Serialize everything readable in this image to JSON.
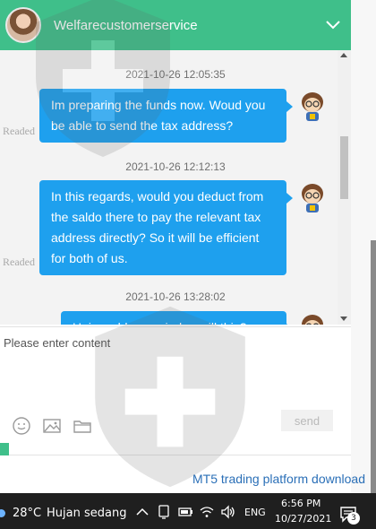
{
  "header": {
    "title": "Welfarecustomerservice",
    "accent": "#3fbf8a"
  },
  "messages": [
    {
      "time": "2021-10-26 12:05:35",
      "status": "Readed",
      "text": "Im preparing the funds now. Woud you be able to send the tax address?"
    },
    {
      "time": "2021-10-26 12:12:13",
      "status": "Readed",
      "text": "In this regards, would you deduct from the saldo there to pay the relevant tax address directly? So it will be efficient for both of us."
    },
    {
      "time": "2021-10-26 13:28:02",
      "status": "",
      "text": "Hai would you mind ... will this?"
    }
  ],
  "composer": {
    "placeholder": "Please enter content",
    "send_label": "send"
  },
  "footer": {
    "link_text": "MT5 trading platform download"
  },
  "taskbar": {
    "temperature": "28°C",
    "weather": "Hujan sedang",
    "language": "ENG",
    "time": "6:56 PM",
    "date": "10/27/2021",
    "notification_count": "3"
  },
  "colors": {
    "bubble": "#1ea0ee",
    "link": "#2a6fb7",
    "taskbar": "#1f1f1f"
  }
}
